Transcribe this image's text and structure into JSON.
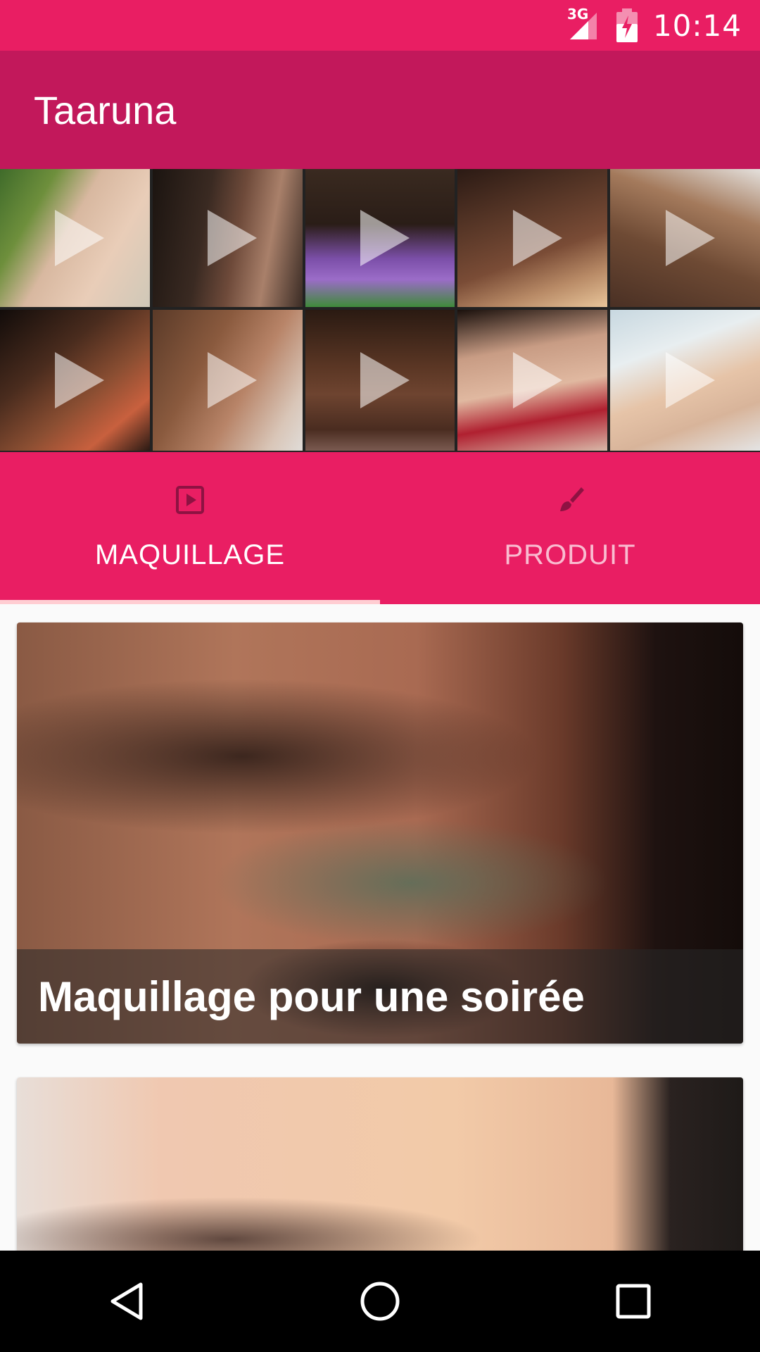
{
  "status_bar": {
    "network": "3G",
    "time": "10:14"
  },
  "app_bar": {
    "title": "Taaruna"
  },
  "header_collage": {
    "tiles": [
      {
        "description": "video thumbnail"
      },
      {
        "description": "video thumbnail"
      },
      {
        "description": "video thumbnail"
      },
      {
        "description": "video thumbnail"
      },
      {
        "description": "video thumbnail"
      },
      {
        "description": "video thumbnail"
      },
      {
        "description": "video thumbnail"
      },
      {
        "description": "video thumbnail"
      },
      {
        "description": "video thumbnail"
      },
      {
        "description": "video thumbnail"
      }
    ]
  },
  "tabs": [
    {
      "label": "MAQUILLAGE",
      "icon": "play-box-icon",
      "selected": true
    },
    {
      "label": "PRODUIT",
      "icon": "brush-icon",
      "selected": false
    }
  ],
  "cards": [
    {
      "title": "Maquillage pour une soirée"
    },
    {
      "title": ""
    }
  ],
  "colors": {
    "primary": "#e91e63",
    "primary_dark": "#c2185b",
    "background": "#fafafa"
  }
}
